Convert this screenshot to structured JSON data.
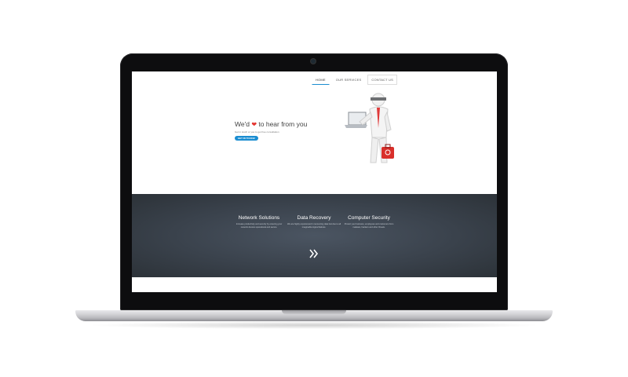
{
  "nav": {
    "tabs": [
      "HOME",
      "OUR SERVICES",
      "CONTACT US"
    ],
    "active_index": 0
  },
  "hero": {
    "heading_before": "We'd",
    "heading_after": "to hear from you",
    "heart_icon": "heart-icon",
    "subtext": "Get in touch or you to get free consultation",
    "cta_label": "GET IN TOUCH!"
  },
  "services": [
    {
      "title": "Network Solutions",
      "desc": "Increase productivity and security by ensuring your network devices operational and secure."
    },
    {
      "title": "Data Recovery",
      "desc": "We are highly experienced in recovering data lost due to all imaginable logical failures."
    },
    {
      "title": "Computer Security",
      "desc": "Protect your business, employees and customers from malware, hackers and other threats."
    }
  ],
  "icons": {
    "scroll": "double-chevron-right-icon",
    "illustration": "support-figure-illustration"
  },
  "colors": {
    "accent": "#1a8dd1",
    "heart": "#e4342f",
    "band": "#3a424c"
  }
}
